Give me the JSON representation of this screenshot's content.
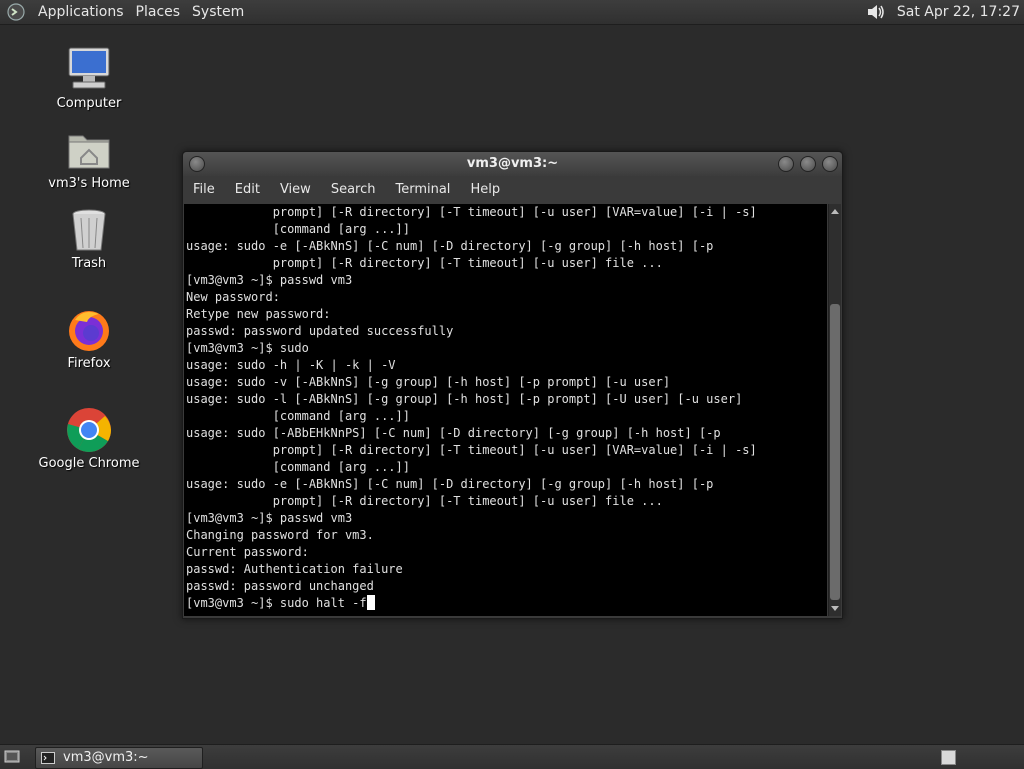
{
  "top_panel": {
    "menus": [
      "Applications",
      "Places",
      "System"
    ],
    "clock": "Sat Apr 22, 17:27",
    "icons": {
      "menu_logo": "distro-logo-icon",
      "volume": "volume-icon"
    }
  },
  "desktop": {
    "icons": [
      {
        "label": "Computer",
        "icon": "computer-icon"
      },
      {
        "label": "vm3's Home",
        "icon": "home-folder-icon"
      },
      {
        "label": "Trash",
        "icon": "trash-icon"
      },
      {
        "label": "Firefox",
        "icon": "firefox-icon"
      },
      {
        "label": "Google Chrome",
        "icon": "chrome-icon"
      }
    ]
  },
  "terminal_window": {
    "title": "vm3@vm3:~",
    "menus": [
      "File",
      "Edit",
      "View",
      "Search",
      "Terminal",
      "Help"
    ],
    "lines": [
      "            prompt] [-R directory] [-T timeout] [-u user] [VAR=value] [-i | -s]",
      "            [command [arg ...]]",
      "usage: sudo -e [-ABkNnS] [-C num] [-D directory] [-g group] [-h host] [-p",
      "            prompt] [-R directory] [-T timeout] [-u user] file ...",
      "[vm3@vm3 ~]$ passwd vm3",
      "New password:",
      "Retype new password:",
      "passwd: password updated successfully",
      "[vm3@vm3 ~]$ sudo",
      "usage: sudo -h | -K | -k | -V",
      "usage: sudo -v [-ABkNnS] [-g group] [-h host] [-p prompt] [-u user]",
      "usage: sudo -l [-ABkNnS] [-g group] [-h host] [-p prompt] [-U user] [-u user]",
      "            [command [arg ...]]",
      "usage: sudo [-ABbEHkNnPS] [-C num] [-D directory] [-g group] [-h host] [-p",
      "            prompt] [-R directory] [-T timeout] [-u user] [VAR=value] [-i | -s]",
      "            [command [arg ...]]",
      "usage: sudo -e [-ABkNnS] [-C num] [-D directory] [-g group] [-h host] [-p",
      "            prompt] [-R directory] [-T timeout] [-u user] file ...",
      "[vm3@vm3 ~]$ passwd vm3",
      "Changing password for vm3.",
      "Current password:",
      "passwd: Authentication failure",
      "passwd: password unchanged"
    ],
    "prompt_line": "[vm3@vm3 ~]$ sudo halt -f"
  },
  "bottom_panel": {
    "task_label": "vm3@vm3:~",
    "icons": {
      "show_desktop": "show-desktop-icon",
      "task": "terminal-icon",
      "workspace": "workspace-switcher-icon"
    }
  }
}
